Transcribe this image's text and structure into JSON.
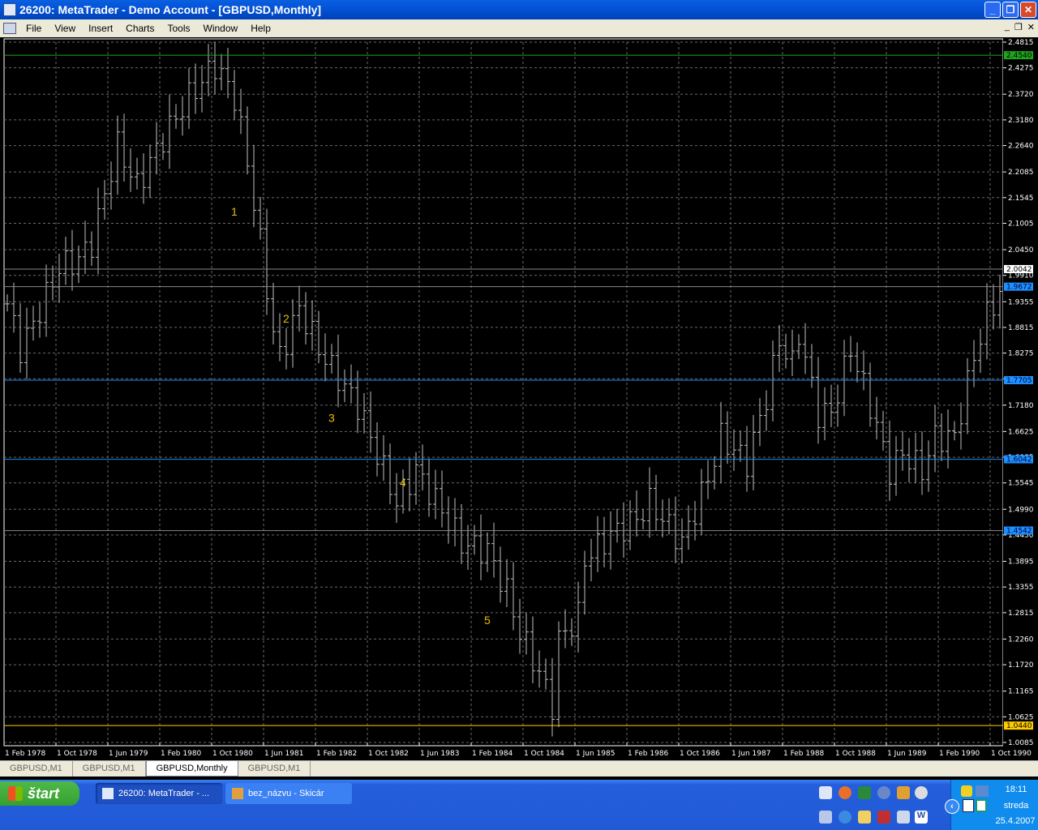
{
  "window": {
    "title": "26200: MetaTrader - Demo Account - [GBPUSD,Monthly]",
    "min": "_",
    "max": "❐",
    "close": "✕"
  },
  "menu": [
    "File",
    "View",
    "Insert",
    "Charts",
    "Tools",
    "Window",
    "Help"
  ],
  "mdi_controls": [
    "_",
    "❐",
    "✕"
  ],
  "tabs": [
    {
      "label": "GBPUSD,M1",
      "active": false
    },
    {
      "label": "GBPUSD,M1",
      "active": false
    },
    {
      "label": "GBPUSD,Monthly",
      "active": true
    },
    {
      "label": "GBPUSD,M1",
      "active": false
    }
  ],
  "taskbar": {
    "start": "štart",
    "tasks": [
      "26200: MetaTrader - ...",
      "bez_názvu - Skicár"
    ],
    "clock": {
      "time": "18:11",
      "day": "streda",
      "date": "25.4.2007"
    }
  },
  "colors": {
    "bg": "#000000",
    "grid": "#6a6a6a",
    "bars": "#bfbfbf",
    "green": "#1ea51e",
    "blue": "#1e90ff",
    "yellow": "#ffcc00",
    "annot": "#e6c000"
  },
  "chart_data": {
    "type": "ohlc",
    "symbol": "GBPUSD",
    "timeframe": "Monthly",
    "ylim": [
      1.0085,
      2.4815
    ],
    "y_ticks": [
      "2.4815",
      "2.4275",
      "2.3720",
      "2.3180",
      "2.2640",
      "2.2085",
      "2.1545",
      "2.1005",
      "2.0450",
      "1.9910",
      "1.9355",
      "1.8815",
      "1.8275",
      "1.7735",
      "1.7180",
      "1.6625",
      "1.6085",
      "1.5545",
      "1.4990",
      "1.4450",
      "1.3895",
      "1.3355",
      "1.2815",
      "1.2260",
      "1.1720",
      "1.1165",
      "1.0625",
      "1.0085"
    ],
    "x_ticks": [
      "1 Feb 1978",
      "1 Oct 1978",
      "1 Jun 1979",
      "1 Feb 1980",
      "1 Oct 1980",
      "1 Jun 1981",
      "1 Feb 1982",
      "1 Oct 1982",
      "1 Jun 1983",
      "1 Feb 1984",
      "1 Oct 1984",
      "1 Jun 1985",
      "1 Feb 1986",
      "1 Oct 1986",
      "1 Jun 1987",
      "1 Feb 1988",
      "1 Oct 1988",
      "1 Jun 1989",
      "1 Feb 1990",
      "1 Oct 1990"
    ],
    "months_per_tick": 8,
    "bar_count": 154,
    "close_keypoints": [
      [
        0,
        1.931
      ],
      [
        2,
        1.837
      ],
      [
        4,
        1.888
      ],
      [
        8,
        2.008
      ],
      [
        11,
        2.025
      ],
      [
        13,
        2.059
      ],
      [
        17,
        2.263
      ],
      [
        20,
        2.178
      ],
      [
        24,
        2.28
      ],
      [
        28,
        2.366
      ],
      [
        32,
        2.434
      ],
      [
        35,
        2.366
      ],
      [
        37,
        2.229
      ],
      [
        39,
        2.059
      ],
      [
        41,
        1.871
      ],
      [
        42,
        1.82
      ],
      [
        45,
        1.922
      ],
      [
        48,
        1.837
      ],
      [
        50,
        1.794
      ],
      [
        54,
        1.718
      ],
      [
        57,
        1.616
      ],
      [
        60,
        1.513
      ],
      [
        63,
        1.581
      ],
      [
        67,
        1.496
      ],
      [
        70,
        1.428
      ],
      [
        74,
        1.411
      ],
      [
        77,
        1.325
      ],
      [
        79,
        1.24
      ],
      [
        82,
        1.155
      ],
      [
        84,
        1.087
      ],
      [
        85,
        1.223
      ],
      [
        88,
        1.274
      ],
      [
        89,
        1.394
      ],
      [
        93,
        1.445
      ],
      [
        97,
        1.479
      ],
      [
        99,
        1.513
      ],
      [
        104,
        1.428
      ],
      [
        108,
        1.564
      ],
      [
        110,
        1.65
      ],
      [
        114,
        1.598
      ],
      [
        117,
        1.735
      ],
      [
        119,
        1.854
      ],
      [
        121,
        1.803
      ],
      [
        122,
        1.871
      ],
      [
        125,
        1.701
      ],
      [
        127,
        1.701
      ],
      [
        130,
        1.837
      ],
      [
        133,
        1.718
      ],
      [
        136,
        1.581
      ],
      [
        138,
        1.616
      ],
      [
        141,
        1.581
      ],
      [
        143,
        1.65
      ],
      [
        146,
        1.65
      ],
      [
        149,
        1.82
      ],
      [
        151,
        1.905
      ],
      [
        153,
        1.956
      ]
    ],
    "levels": [
      {
        "price": "2.4540",
        "color": "green"
      },
      {
        "price": "2.0042",
        "color": "white"
      },
      {
        "price": "1.9672",
        "color": "blue"
      },
      {
        "price": "1.7705",
        "color": "blue"
      },
      {
        "price": "1.6042",
        "color": "blue"
      },
      {
        "price": "1.4542",
        "color": "blue"
      },
      {
        "price": "1.0440",
        "color": "yellow"
      }
    ],
    "annotations": [
      {
        "text": "1",
        "bar": 35,
        "price": 2.125
      },
      {
        "text": "2",
        "bar": 43,
        "price": 1.9
      },
      {
        "text": "3",
        "bar": 50,
        "price": 1.691
      },
      {
        "text": "4",
        "bar": 61,
        "price": 1.556
      },
      {
        "text": "5",
        "bar": 74,
        "price": 1.266
      }
    ]
  }
}
